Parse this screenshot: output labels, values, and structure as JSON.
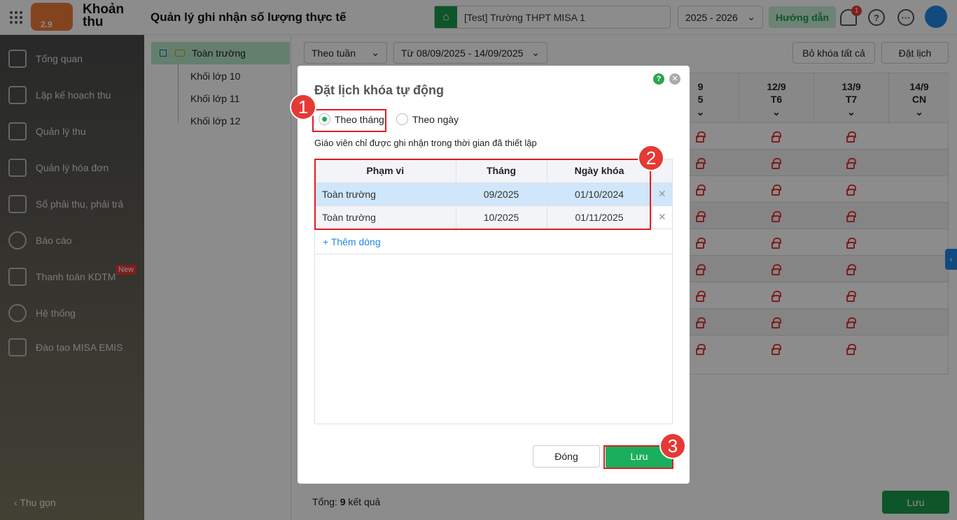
{
  "header": {
    "app_name": "Khoản thu",
    "logo_text": "2.9",
    "page_title": "Quản lý ghi nhận số lượng thực tế",
    "school": "[Test] Trường THPT MISA 1",
    "year": "2025 - 2026",
    "guide": "Hướng dẫn",
    "notification_count": "1"
  },
  "sidebar": {
    "items": [
      {
        "label": "Tổng quan"
      },
      {
        "label": "Lập kế hoạch thu"
      },
      {
        "label": "Quản lý thu"
      },
      {
        "label": "Quản lý hóa đơn"
      },
      {
        "label": "Sổ phải thu, phải trả"
      },
      {
        "label": "Báo cáo"
      },
      {
        "label": "Thanh toán KDTM",
        "badge": "New"
      },
      {
        "label": "Hệ thống"
      },
      {
        "label": "Đào tạo MISA EMIS"
      }
    ],
    "collapse": "Thu gọn"
  },
  "tree": {
    "root": "Toàn trường",
    "children": [
      "Khối lớp 10",
      "Khối lớp 11",
      "Khối lớp 12"
    ]
  },
  "toolbar": {
    "period": "Theo tuần",
    "range": "Từ 08/09/2025 - 14/09/2025",
    "unlock_all": "Bỏ khóa tất cả",
    "schedule": "Đặt lịch"
  },
  "grid": {
    "columns": [
      {
        "date": "9",
        "day": "5"
      },
      {
        "date": "12/9",
        "day": "T6"
      },
      {
        "date": "13/9",
        "day": "T7"
      },
      {
        "date": "14/9",
        "day": "CN"
      }
    ],
    "locked_columns": [
      "9",
      "12/9",
      "13/9"
    ],
    "row_count": 9
  },
  "footer": {
    "total_prefix": "Tổng: ",
    "total": "9",
    "total_suffix": " kết quả",
    "save": "Lưu"
  },
  "modal": {
    "title": "Đặt lịch khóa tự động",
    "options": [
      "Theo tháng",
      "Theo ngày"
    ],
    "selected": "Theo tháng",
    "hint": "Giáo viên chỉ được ghi nhận trong thời gian đã thiết lập",
    "headers": [
      "Phạm vi",
      "Tháng",
      "Ngày khóa"
    ],
    "rows": [
      {
        "scope": "Toàn trường",
        "month": "09/2025",
        "lock_date": "01/10/2024"
      },
      {
        "scope": "Toàn trường",
        "month": "10/2025",
        "lock_date": "01/11/2025"
      }
    ],
    "add_row": "+ Thêm dòng",
    "close": "Đóng",
    "save": "Lưu"
  },
  "annotations": [
    "1",
    "2",
    "3"
  ],
  "colors": {
    "primary": "#1aaf5d",
    "highlight": "#e31b23",
    "selected_row": "#cfe6fb"
  }
}
